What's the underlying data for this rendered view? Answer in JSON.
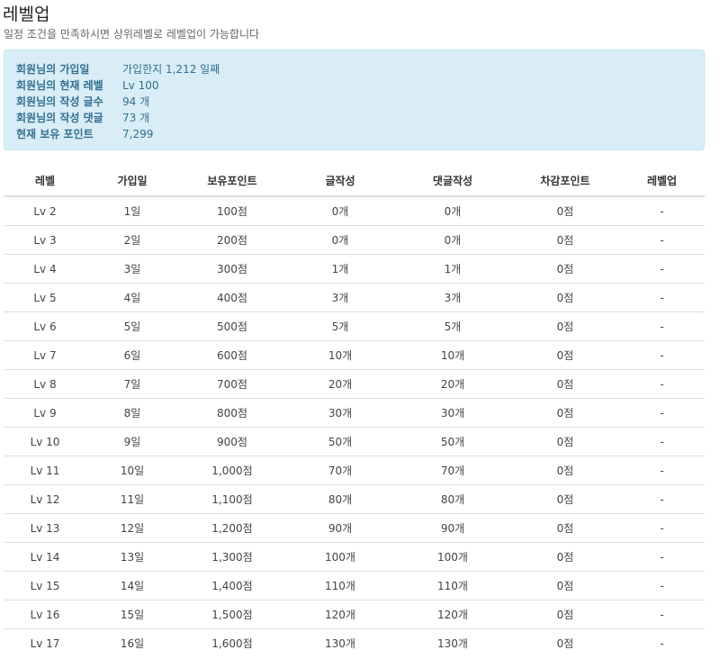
{
  "header": {
    "title": "레벨업",
    "subtitle": "일정 조건을 만족하시면 상위레벨로 레벨업이 가능합니다"
  },
  "info": [
    {
      "label": "회원님의 가입일",
      "value": "가입한지 1,212 일째"
    },
    {
      "label": "회원님의 현재 레벨",
      "value": "Lv 100"
    },
    {
      "label": "회원님의 작성 글수",
      "value": "94 개"
    },
    {
      "label": "회원님의 작성 댓글",
      "value": "73 개"
    },
    {
      "label": "현재 보유 포인트",
      "value": "7,299"
    }
  ],
  "table": {
    "headers": [
      "레벨",
      "가입일",
      "보유포인트",
      "글작성",
      "댓글작성",
      "차감포인트",
      "레벨업"
    ],
    "rows": [
      [
        "Lv 2",
        "1일",
        "100점",
        "0개",
        "0개",
        "0점",
        "-"
      ],
      [
        "Lv 3",
        "2일",
        "200점",
        "0개",
        "0개",
        "0점",
        "-"
      ],
      [
        "Lv 4",
        "3일",
        "300점",
        "1개",
        "1개",
        "0점",
        "-"
      ],
      [
        "Lv 5",
        "4일",
        "400점",
        "3개",
        "3개",
        "0점",
        "-"
      ],
      [
        "Lv 6",
        "5일",
        "500점",
        "5개",
        "5개",
        "0점",
        "-"
      ],
      [
        "Lv 7",
        "6일",
        "600점",
        "10개",
        "10개",
        "0점",
        "-"
      ],
      [
        "Lv 8",
        "7일",
        "700점",
        "20개",
        "20개",
        "0점",
        "-"
      ],
      [
        "Lv 9",
        "8일",
        "800점",
        "30개",
        "30개",
        "0점",
        "-"
      ],
      [
        "Lv 10",
        "9일",
        "900점",
        "50개",
        "50개",
        "0점",
        "-"
      ],
      [
        "Lv 11",
        "10일",
        "1,000점",
        "70개",
        "70개",
        "0점",
        "-"
      ],
      [
        "Lv 12",
        "11일",
        "1,100점",
        "80개",
        "80개",
        "0점",
        "-"
      ],
      [
        "Lv 13",
        "12일",
        "1,200점",
        "90개",
        "90개",
        "0점",
        "-"
      ],
      [
        "Lv 14",
        "13일",
        "1,300점",
        "100개",
        "100개",
        "0점",
        "-"
      ],
      [
        "Lv 15",
        "14일",
        "1,400점",
        "110개",
        "110개",
        "0점",
        "-"
      ],
      [
        "Lv 16",
        "15일",
        "1,500점",
        "120개",
        "120개",
        "0점",
        "-"
      ],
      [
        "Lv 17",
        "16일",
        "1,600점",
        "130개",
        "130개",
        "0점",
        "-"
      ]
    ]
  }
}
